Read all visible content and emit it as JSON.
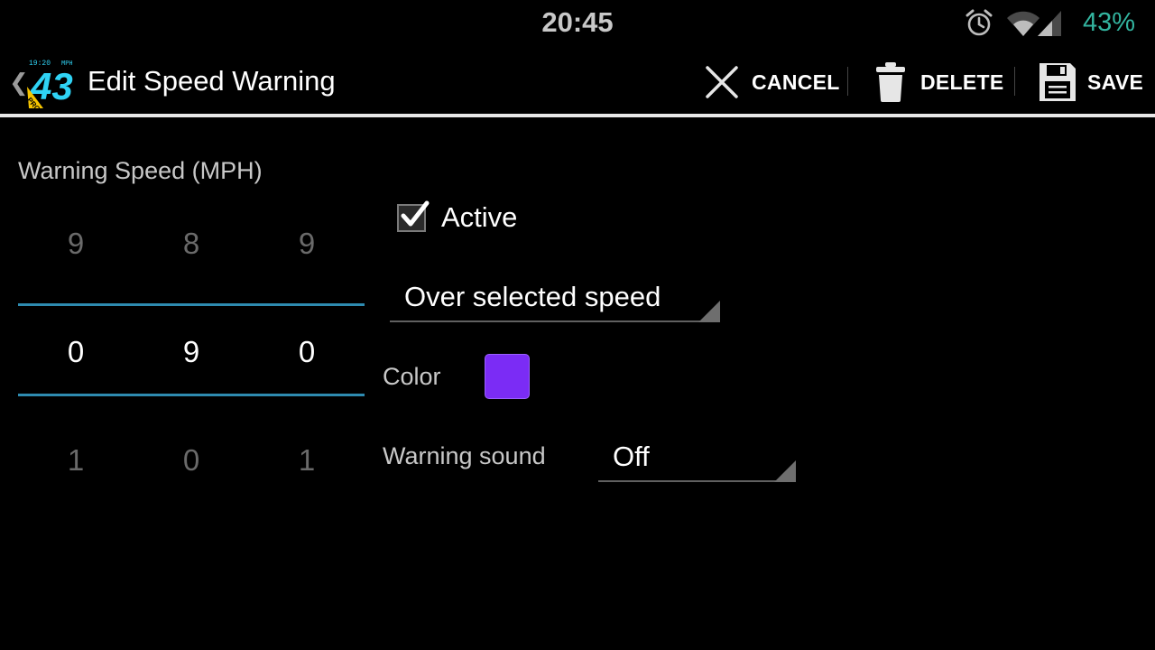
{
  "status_bar": {
    "time": "20:45",
    "battery": "43%",
    "icons": [
      "alarm-icon",
      "wifi-icon",
      "signal-icon"
    ]
  },
  "action_bar": {
    "title": "Edit Speed Warning",
    "logo_text": {
      "time": "19:20",
      "unit": "MPH",
      "speed": "43",
      "badge": "PRO"
    },
    "cancel_label": "CANCEL",
    "delete_label": "DELETE",
    "save_label": "SAVE"
  },
  "speed_picker": {
    "label": "Warning Speed (MPH)",
    "columns": [
      {
        "prev": "9",
        "value": "0",
        "next": "1"
      },
      {
        "prev": "8",
        "value": "9",
        "next": "0"
      },
      {
        "prev": "9",
        "value": "0",
        "next": "1"
      }
    ]
  },
  "options": {
    "active": {
      "label": "Active",
      "checked": true
    },
    "condition": {
      "value": "Over selected speed"
    },
    "color": {
      "label": "Color",
      "value": "#7b2cf5"
    },
    "warning_sound": {
      "label": "Warning sound",
      "value": "Off"
    }
  },
  "colors": {
    "accent": "#2e8bb0",
    "battery": "#33b5a0",
    "logo": "#2fd3f5",
    "badge": "#f5c400"
  }
}
